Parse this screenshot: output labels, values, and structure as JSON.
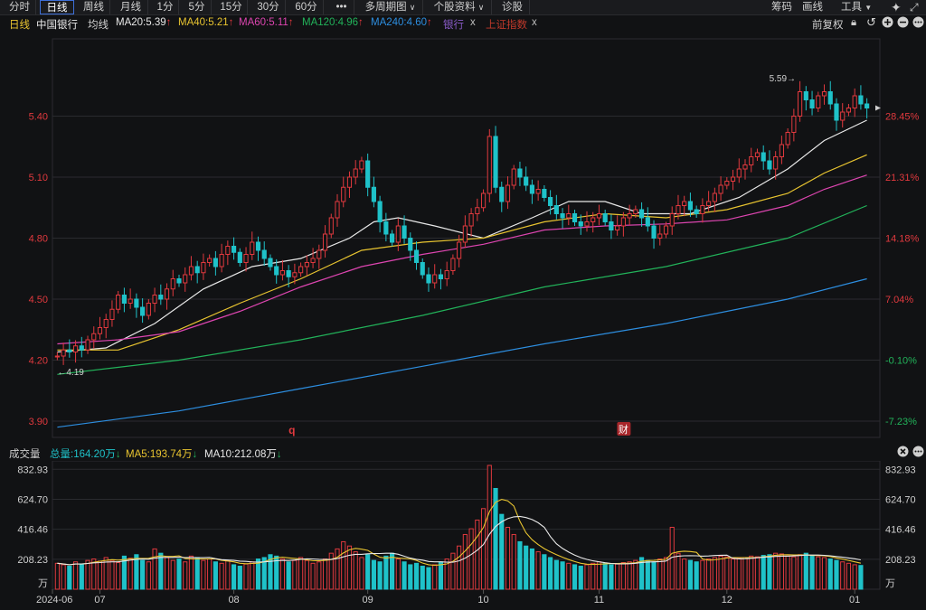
{
  "toolbar": {
    "periods": [
      "分时",
      "日线",
      "周线",
      "月线",
      "1分",
      "5分",
      "15分",
      "30分",
      "60分"
    ],
    "active_period": "日线",
    "more": "•••",
    "multi_period": "多周期图",
    "stock_info": "个股资料",
    "diagnose": "诊股",
    "chips": "筹码",
    "draw": "画线",
    "tools": "工具"
  },
  "infobar": {
    "period": "日线",
    "stock": "中国银行",
    "ma_label": "均线",
    "ma20": "MA20:5.39",
    "ma40": "MA40:5.21",
    "ma60": "MA60:5.11",
    "ma120": "MA120:4.96",
    "ma240": "MA240:4.60",
    "compare1": "银行",
    "compare2": "上证指数",
    "close_x": "x",
    "adjust": "前复权"
  },
  "colors": {
    "up": "#e0393e",
    "down": "#1fc2c9",
    "ma20": "#e8e8e8",
    "ma40": "#e8c430",
    "ma60": "#dd45b0",
    "ma120": "#22b35a",
    "ma240": "#2d8ee0",
    "compare1": "#8a5cc9",
    "compare2": "#c0392b",
    "grid": "#2a2b2f"
  },
  "chart_data": [
    {
      "type": "candlestick",
      "title": "中国银行 日线",
      "ylim": [
        3.82,
        5.78
      ],
      "y_ticks": [
        "5.40",
        "5.10",
        "4.80",
        "4.50",
        "4.20",
        "3.90"
      ],
      "y_tick_values": [
        5.4,
        5.1,
        4.8,
        4.5,
        4.2,
        3.9
      ],
      "pct_ticks": [
        "28.45%",
        "21.31%",
        "14.18%",
        "7.04%",
        "-0.10%",
        "-7.23%"
      ],
      "high_label": "5.59",
      "low_label": "4.19",
      "markers": [
        "q",
        "财"
      ],
      "x_ticks": [
        "2024-06",
        "07",
        "08",
        "09",
        "10",
        "11",
        "12",
        "01"
      ],
      "ohlc_start": 4.22,
      "close_path": [
        4.22,
        4.25,
        4.24,
        4.27,
        4.25,
        4.3,
        4.33,
        4.36,
        4.4,
        4.45,
        4.52,
        4.48,
        4.5,
        4.46,
        4.42,
        4.48,
        4.52,
        4.5,
        4.55,
        4.6,
        4.58,
        4.62,
        4.66,
        4.63,
        4.68,
        4.7,
        4.66,
        4.72,
        4.76,
        4.73,
        4.68,
        4.72,
        4.78,
        4.74,
        4.7,
        4.66,
        4.62,
        4.64,
        4.61,
        4.63,
        4.66,
        4.68,
        4.7,
        4.74,
        4.82,
        4.9,
        4.98,
        5.05,
        5.1,
        5.14,
        5.18,
        5.05,
        4.98,
        4.88,
        4.82,
        4.78,
        4.86,
        4.8,
        4.74,
        4.68,
        4.62,
        4.58,
        4.62,
        4.6,
        4.64,
        4.7,
        4.78,
        4.86,
        4.92,
        4.95,
        5.02,
        5.3,
        5.05,
        4.98,
        5.06,
        5.14,
        5.1,
        5.06,
        5.02,
        5.04,
        5.0,
        4.96,
        4.92,
        4.9,
        4.92,
        4.88,
        4.86,
        4.88,
        4.9,
        4.92,
        4.88,
        4.84,
        4.86,
        4.9,
        4.92,
        4.94,
        4.9,
        4.86,
        4.8,
        4.82,
        4.86,
        4.92,
        4.96,
        4.98,
        4.94,
        4.92,
        4.96,
        4.98,
        5.02,
        5.06,
        5.08,
        5.1,
        5.14,
        5.16,
        5.2,
        5.22,
        5.18,
        5.14,
        5.2,
        5.26,
        5.32,
        5.4,
        5.52,
        5.48,
        5.44,
        5.5,
        5.52,
        5.46,
        5.38,
        5.42,
        5.44,
        5.5,
        5.46,
        5.44
      ],
      "ma": {
        "MA20": [
          [
            0,
            4.24
          ],
          [
            8,
            4.26
          ],
          [
            16,
            4.38
          ],
          [
            24,
            4.55
          ],
          [
            32,
            4.66
          ],
          [
            40,
            4.7
          ],
          [
            48,
            4.8
          ],
          [
            52,
            4.88
          ],
          [
            56,
            4.9
          ],
          [
            62,
            4.86
          ],
          [
            70,
            4.8
          ],
          [
            78,
            4.9
          ],
          [
            84,
            4.98
          ],
          [
            90,
            4.98
          ],
          [
            96,
            4.92
          ],
          [
            104,
            4.92
          ],
          [
            112,
            5.0
          ],
          [
            120,
            5.14
          ],
          [
            126,
            5.28
          ],
          [
            133,
            5.38
          ]
        ],
        "MA40": [
          [
            0,
            4.25
          ],
          [
            10,
            4.25
          ],
          [
            20,
            4.35
          ],
          [
            30,
            4.48
          ],
          [
            40,
            4.6
          ],
          [
            50,
            4.74
          ],
          [
            60,
            4.78
          ],
          [
            70,
            4.8
          ],
          [
            80,
            4.88
          ],
          [
            90,
            4.92
          ],
          [
            100,
            4.9
          ],
          [
            110,
            4.94
          ],
          [
            120,
            5.02
          ],
          [
            126,
            5.12
          ],
          [
            133,
            5.21
          ]
        ],
        "MA60": [
          [
            0,
            4.28
          ],
          [
            10,
            4.3
          ],
          [
            20,
            4.34
          ],
          [
            30,
            4.44
          ],
          [
            40,
            4.56
          ],
          [
            50,
            4.66
          ],
          [
            60,
            4.72
          ],
          [
            70,
            4.77
          ],
          [
            80,
            4.84
          ],
          [
            90,
            4.86
          ],
          [
            100,
            4.87
          ],
          [
            110,
            4.89
          ],
          [
            120,
            4.96
          ],
          [
            126,
            5.04
          ],
          [
            133,
            5.11
          ]
        ],
        "MA120": [
          [
            0,
            4.13
          ],
          [
            20,
            4.2
          ],
          [
            40,
            4.3
          ],
          [
            60,
            4.42
          ],
          [
            80,
            4.56
          ],
          [
            100,
            4.66
          ],
          [
            120,
            4.8
          ],
          [
            133,
            4.96
          ]
        ],
        "MA240": [
          [
            0,
            3.87
          ],
          [
            20,
            3.95
          ],
          [
            40,
            4.06
          ],
          [
            60,
            4.17
          ],
          [
            80,
            4.28
          ],
          [
            100,
            4.38
          ],
          [
            120,
            4.5
          ],
          [
            133,
            4.6
          ]
        ]
      }
    },
    {
      "type": "bar",
      "title": "成交量",
      "units": "万",
      "ylim": [
        0,
        860
      ],
      "y_ticks": [
        "832.93",
        "624.70",
        "416.46",
        "208.23"
      ],
      "y_tick_values": [
        832.93,
        624.7,
        416.46,
        208.23
      ],
      "totals": {
        "volume": "总量:164.20万",
        "ma5": "MA5:193.74万",
        "ma10": "MA10:212.08万"
      },
      "volume_path": [
        180,
        170,
        160,
        190,
        175,
        200,
        210,
        195,
        220,
        200,
        185,
        230,
        215,
        240,
        200,
        190,
        280,
        250,
        220,
        200,
        210,
        190,
        230,
        220,
        200,
        210,
        190,
        180,
        200,
        170,
        160,
        175,
        190,
        210,
        220,
        240,
        230,
        210,
        190,
        200,
        220,
        200,
        180,
        190,
        210,
        250,
        280,
        330,
        300,
        260,
        220,
        240,
        200,
        190,
        230,
        250,
        210,
        190,
        170,
        180,
        160,
        150,
        170,
        190,
        210,
        250,
        300,
        380,
        420,
        480,
        560,
        860,
        700,
        520,
        430,
        380,
        330,
        300,
        280,
        260,
        240,
        220,
        200,
        190,
        180,
        170,
        160,
        170,
        180,
        190,
        180,
        170,
        175,
        185,
        190,
        200,
        220,
        200,
        190,
        210,
        220,
        430,
        250,
        210,
        200,
        190,
        200,
        210,
        220,
        230,
        225,
        210,
        215,
        220,
        230,
        225,
        235,
        240,
        250,
        245,
        230,
        225,
        240,
        250,
        230,
        225,
        220,
        210,
        200,
        190,
        180,
        170,
        165
      ]
    }
  ]
}
